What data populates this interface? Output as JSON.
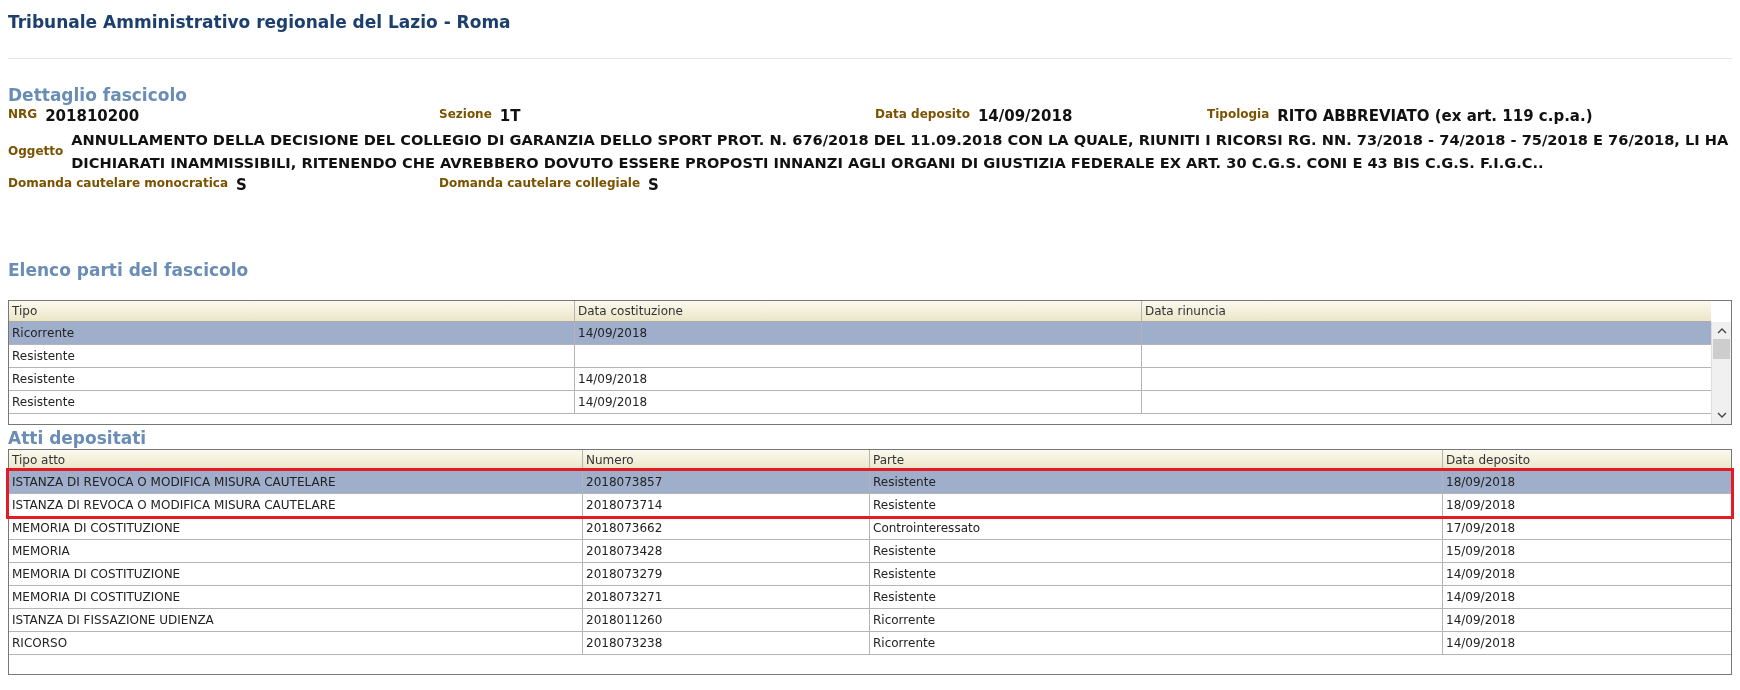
{
  "page": {
    "title": "Tribunale Amministrativo regionale del Lazio - Roma"
  },
  "dettaglio": {
    "heading": "Dettaglio fascicolo",
    "fields_row1": [
      {
        "label": "NRG",
        "value": "201810200"
      },
      {
        "label": "Sezione",
        "value": "1T"
      },
      {
        "label": "Data deposito",
        "value": "14/09/2018"
      },
      {
        "label": "Tipologia",
        "value": "RITO ABBREVIATO (ex art. 119 c.p.a.)"
      }
    ],
    "oggetto": {
      "label": "Oggetto",
      "value": "ANNULLAMENTO DELLA DECISIONE DEL COLLEGIO DI GARANZIA DELLO SPORT PROT. N. 676/2018 DEL 11.09.2018 CON LA QUALE, RIUNITI I RICORSI RG. NN. 73/2018 - 74/2018 - 75/2018 E 76/2018, LI HA DICHIARATI INAMMISSIBILI, RITENENDO CHE AVREBBERO DOVUTO ESSERE PROPOSTI INNANZI AGLI ORGANI DI GIUSTIZIA FEDERALE EX ART. 30 C.G.S. CONI E 43 BIS C.G.S. F.I.G.C.."
    },
    "fields_row2": [
      {
        "label": "Domanda cautelare monocratica",
        "value": "S"
      },
      {
        "label": "Domanda cautelare collegiale",
        "value": "S"
      }
    ]
  },
  "parti": {
    "heading": "Elenco parti del fascicolo",
    "columns": [
      "Tipo",
      "Data costituzione",
      "Data rinuncia"
    ],
    "rows": [
      {
        "cells": [
          "Ricorrente",
          "14/09/2018",
          ""
        ],
        "selected": true
      },
      {
        "cells": [
          "Resistente",
          "",
          ""
        ],
        "selected": false
      },
      {
        "cells": [
          "Resistente",
          "14/09/2018",
          ""
        ],
        "selected": false
      },
      {
        "cells": [
          "Resistente",
          "14/09/2018",
          ""
        ],
        "selected": false
      }
    ]
  },
  "atti": {
    "heading": "Atti depositati",
    "columns": [
      "Tipo atto",
      "Numero",
      "Parte",
      "Data deposito"
    ],
    "rows": [
      {
        "cells": [
          "ISTANZA DI REVOCA O MODIFICA MISURA CAUTELARE",
          "2018073857",
          "Resistente",
          "18/09/2018"
        ],
        "selected": true,
        "highlighted": true
      },
      {
        "cells": [
          "ISTANZA DI REVOCA O MODIFICA MISURA CAUTELARE",
          "2018073714",
          "Resistente",
          "18/09/2018"
        ],
        "selected": false,
        "highlighted": true
      },
      {
        "cells": [
          "MEMORIA DI COSTITUZIONE",
          "2018073662",
          "Controinteressato",
          "17/09/2018"
        ],
        "selected": false,
        "highlighted": false
      },
      {
        "cells": [
          "MEMORIA",
          "2018073428",
          "Resistente",
          "15/09/2018"
        ],
        "selected": false,
        "highlighted": false
      },
      {
        "cells": [
          "MEMORIA DI COSTITUZIONE",
          "2018073279",
          "Resistente",
          "14/09/2018"
        ],
        "selected": false,
        "highlighted": false
      },
      {
        "cells": [
          "MEMORIA DI COSTITUZIONE",
          "2018073271",
          "Resistente",
          "14/09/2018"
        ],
        "selected": false,
        "highlighted": false
      },
      {
        "cells": [
          "ISTANZA DI FISSAZIONE UDIENZA",
          "2018011260",
          "Ricorrente",
          "14/09/2018"
        ],
        "selected": false,
        "highlighted": false
      },
      {
        "cells": [
          "RICORSO",
          "2018073238",
          "Ricorrente",
          "14/09/2018"
        ],
        "selected": false,
        "highlighted": false
      }
    ]
  }
}
